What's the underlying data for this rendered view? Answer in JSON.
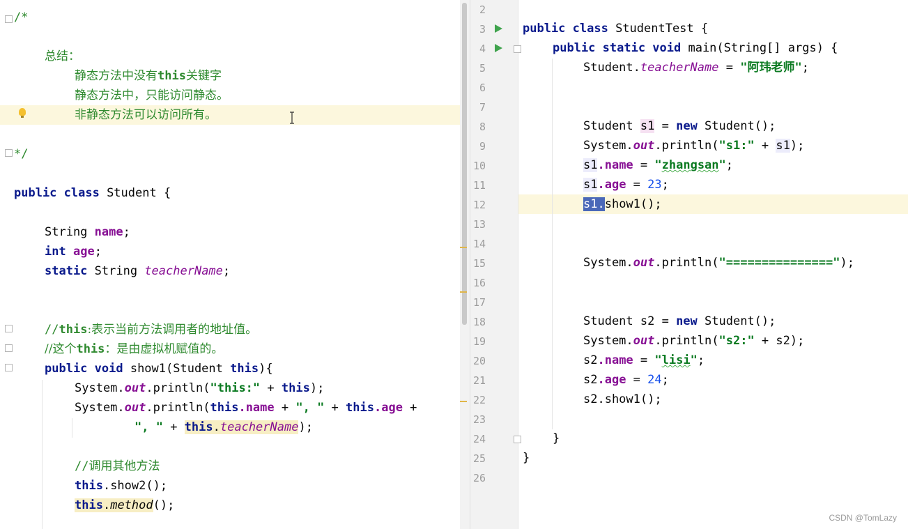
{
  "left_editor": {
    "comment_open": "/*",
    "summary_title": "总结：",
    "summary_line1_a": "静态方法中没有",
    "summary_line1_kw": "this",
    "summary_line1_b": "关键字",
    "summary_line2": "静态方法中，只能访问静态。",
    "summary_line3": "非静态方法可以访问所有。",
    "comment_close": "*/",
    "class_decl_kw": "public class",
    "class_decl_name": " Student {",
    "field1_type": "String ",
    "field1_name": "name",
    "field2_type": "int",
    "field2_name": "age",
    "field3_kw": "static",
    "field3_type": " String ",
    "field3_name": "teacherName",
    "comment_this1_a": "//",
    "comment_this1_kw": "this",
    "comment_this1_b": ":表示当前方法调用者的地址值。",
    "comment_this2_a": "//这个",
    "comment_this2_kw": "this",
    "comment_this2_b": "：是由虚拟机赋值的。",
    "method_kw": "public void",
    "method_sig": " show1(Student ",
    "method_param_kw": "this",
    "method_sig_end": "){",
    "println1_a": "System.",
    "println1_out": "out",
    "println1_b": ".println(",
    "println1_str": "\"this:\"",
    "println1_c": " + ",
    "println1_kw": "this",
    "println1_d": ");",
    "println2_a": "System.",
    "println2_out": "out",
    "println2_b": ".println(",
    "println2_kw1": "this",
    "println2_f1": ".name",
    "println2_c": " + ",
    "println2_str1": "\", \"",
    "println2_d": " + ",
    "println2_kw2": "this",
    "println2_f2": ".age",
    "println2_e": " +",
    "println3_str": "\", \"",
    "println3_a": " + ",
    "println3_kw": "this",
    "println3_dot": ".",
    "println3_f": "teacherName",
    "println3_end": ");",
    "comment_call_a": "//",
    "comment_call_b": "调用其他方法",
    "call1_kw": "this",
    "call1_rest": ".show2();",
    "call2_kw": "this",
    "call2_dot": ".",
    "call2_m": "method",
    "call2_rest": "();"
  },
  "right_editor": {
    "line_numbers": [
      "2",
      "3",
      "4",
      "5",
      "6",
      "7",
      "8",
      "9",
      "10",
      "11",
      "12",
      "13",
      "14",
      "15",
      "16",
      "17",
      "18",
      "19",
      "20",
      "21",
      "22",
      "23",
      "24",
      "25",
      "26"
    ],
    "l3_kw": "public class",
    "l3_rest": " StudentTest {",
    "l4_kw": "public static void",
    "l4_rest": " main(String[] args) {",
    "l5_a": "Student.",
    "l5_f": "teacherName",
    "l5_b": " = ",
    "l5_str": "\"阿玮老师\"",
    "l5_c": ";",
    "l8_a": "Student ",
    "l8_v": "s1",
    "l8_b": " = ",
    "l8_kw": "new",
    "l8_c": " Student();",
    "l9_a": "System.",
    "l9_out": "out",
    "l9_b": ".println(",
    "l9_str": "\"s1:\"",
    "l9_c": " + ",
    "l9_v": "s1",
    "l9_d": ");",
    "l10_v": "s1",
    "l10_f": ".name",
    "l10_b": " = ",
    "l10_str_q1": "\"",
    "l10_str_w": "zhangsan",
    "l10_str_q2": "\"",
    "l10_c": ";",
    "l11_v": "s1",
    "l11_f": ".age",
    "l11_b": " = ",
    "l11_num": "23",
    "l11_c": ";",
    "l12_v": "s1.",
    "l12_rest": "show1();",
    "l15_a": "System.",
    "l15_out": "out",
    "l15_b": ".println(",
    "l15_str": "\"===============\"",
    "l15_c": ");",
    "l18_a": "Student s2 = ",
    "l18_kw": "new",
    "l18_c": " Student();",
    "l19_a": "System.",
    "l19_out": "out",
    "l19_b": ".println(",
    "l19_str": "\"s2:\"",
    "l19_c": " + s2);",
    "l20_a": "s2",
    "l20_f": ".name",
    "l20_b": " = ",
    "l20_str_q1": "\"",
    "l20_str_w": "lisi",
    "l20_str_q2": "\"",
    "l20_c": ";",
    "l21_a": "s2",
    "l21_f": ".age",
    "l21_b": " = ",
    "l21_num": "24",
    "l21_c": ";",
    "l22": "s2.show1();",
    "l24": "}",
    "l25": "}"
  },
  "watermark": "CSDN @TomLazy",
  "icons": {
    "run": "run-gutter-icon",
    "fold": "fold-marker-icon",
    "bulb": "intention-bulb-icon",
    "caret": "text-cursor-icon"
  }
}
